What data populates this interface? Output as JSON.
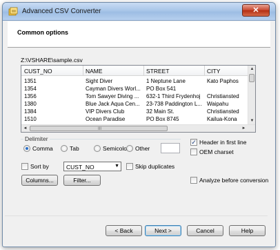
{
  "window": {
    "title": "Advanced CSV Converter",
    "close_glyph": "✕"
  },
  "header": {
    "title": "Common options"
  },
  "file": {
    "path": "Z:\\VSHARE\\sample.csv"
  },
  "grid": {
    "columns": [
      "CUST_NO",
      "NAME",
      "STREET",
      "CITY"
    ],
    "rows": [
      [
        "1351",
        "Sight Diver",
        "1 Neptune Lane",
        "Kato Paphos"
      ],
      [
        "1354",
        "Cayman Divers Worl...",
        "PO Box 541",
        ""
      ],
      [
        "1356",
        "Tom Sawyer Diving ...",
        "632-1 Third Frydenhoj",
        "Christiansted"
      ],
      [
        "1380",
        "Blue Jack Aqua Cen...",
        "23-738 Paddington L...",
        "Waipahu"
      ],
      [
        "1384",
        "VIP Divers Club",
        "32 Main St.",
        "Christiansted"
      ],
      [
        "1510",
        "Ocean Paradise",
        "PO Box 8745",
        "Kailua-Kona"
      ]
    ],
    "up_glyph": "▲",
    "down_glyph": "▼",
    "left_glyph": "◄",
    "right_glyph": "►",
    "grip_glyph": "III"
  },
  "delimiter": {
    "label": "Delimiter",
    "options": [
      "Comma",
      "Tab",
      "Semicolon",
      "Other"
    ],
    "selected": "Comma",
    "other_value": ""
  },
  "header_in_first_line": {
    "label": "Header in first line",
    "checked": true,
    "mark": "✓"
  },
  "oem_charset": {
    "label": "OEM charset",
    "checked": false
  },
  "sort": {
    "label": "Sort by",
    "checked": false,
    "field": "CUST_NO",
    "arrow": "▼"
  },
  "skip_duplicates": {
    "label": "Skip duplicates",
    "checked": false
  },
  "analyze": {
    "label": "Analyze before conversion",
    "checked": false
  },
  "buttons": {
    "columns": "Columns...",
    "filter": "Filter...",
    "back": "< Back",
    "next": "Next >",
    "cancel": "Cancel",
    "help": "Help"
  },
  "colors": {
    "titlebar": "#a9c6e9",
    "close": "#c7452c",
    "accent": "#2a6fc9"
  }
}
